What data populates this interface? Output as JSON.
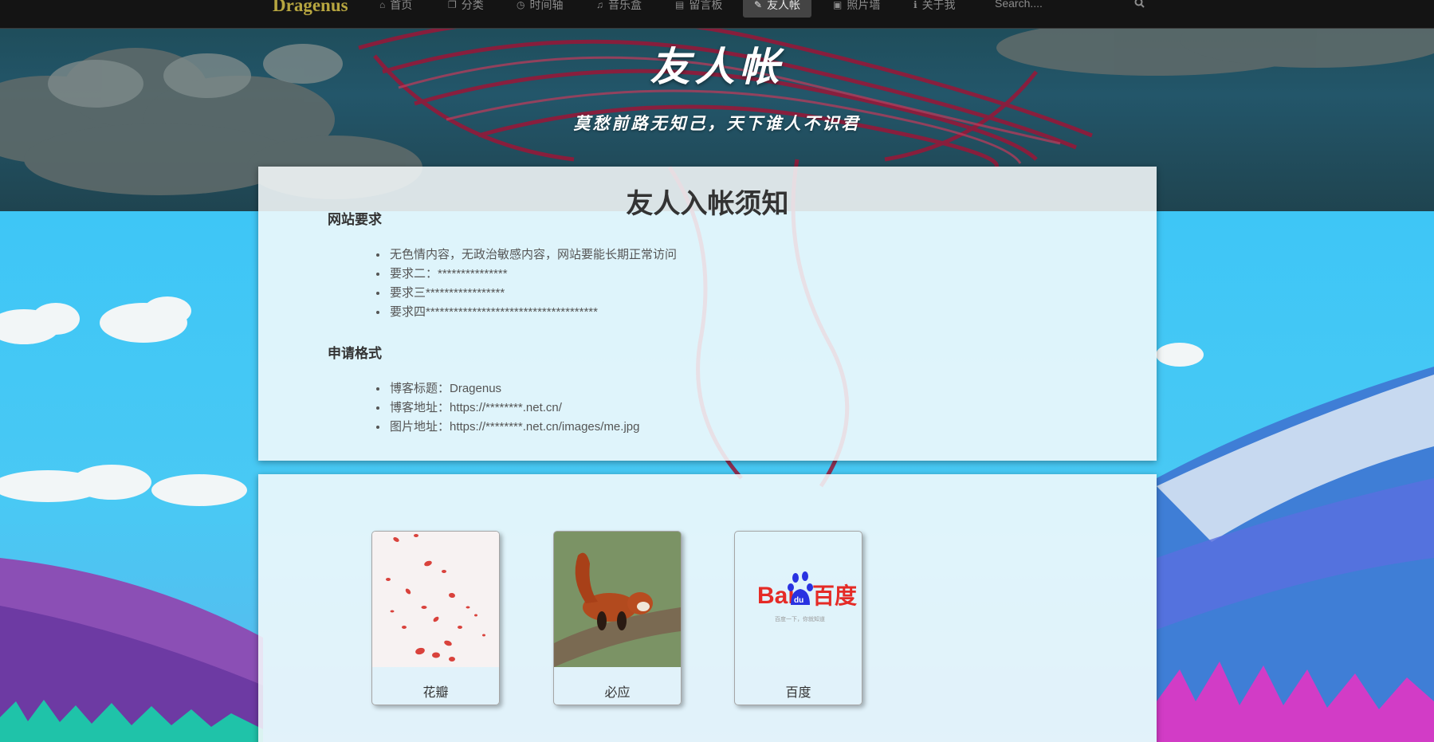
{
  "navbar": {
    "brand": "Dragenus",
    "items": [
      {
        "label": "首页",
        "icon": "home-icon",
        "glyph": "⌂"
      },
      {
        "label": "分类",
        "icon": "copy-icon",
        "glyph": "❐"
      },
      {
        "label": "时间轴",
        "icon": "clock-icon",
        "glyph": "◷"
      },
      {
        "label": "音乐盒",
        "icon": "music-icon",
        "glyph": "♫"
      },
      {
        "label": "留言板",
        "icon": "book-icon",
        "glyph": "▤"
      },
      {
        "label": "友人帐",
        "icon": "pencil-icon",
        "glyph": "✎"
      },
      {
        "label": "照片墙",
        "icon": "picture-icon",
        "glyph": "▣"
      },
      {
        "label": "关于我",
        "icon": "info-icon",
        "glyph": "ℹ"
      }
    ],
    "active_index": 5,
    "search": {
      "placeholder": "Search....",
      "value": ""
    }
  },
  "hero": {
    "title": "友人帐",
    "subtitle": "莫愁前路无知己，天下谁人不识君"
  },
  "notice": {
    "title": "友人入帐须知",
    "sections": [
      {
        "heading": "网站要求",
        "items": [
          "无色情内容，无政治敏感内容，网站要能长期正常访问",
          "要求二：***************",
          "要求三*****************",
          "要求四*************************************"
        ]
      },
      {
        "heading": "申请格式",
        "items": [
          "博客标题：Dragenus",
          "博客地址：https://********.net.cn/",
          "图片地址：https://********.net.cn/images/me.jpg"
        ]
      }
    ]
  },
  "friends": [
    {
      "name": "花瓣",
      "image": "petals-image"
    },
    {
      "name": "必应",
      "image": "red-panda-image"
    },
    {
      "name": "百度",
      "image": "baidu-logo-image",
      "logo_text": "Bai百度",
      "logo_tagline": "百度一下，你就知道"
    }
  ],
  "colors": {
    "navbar_bg": "#141414",
    "brand": "#b7a640",
    "nav_text": "#8c8c8c",
    "nav_active_bg": "#444444",
    "panel_bg": "#f6fafc",
    "baidu_red": "#e52b26",
    "baidu_blue": "#2932e1"
  }
}
